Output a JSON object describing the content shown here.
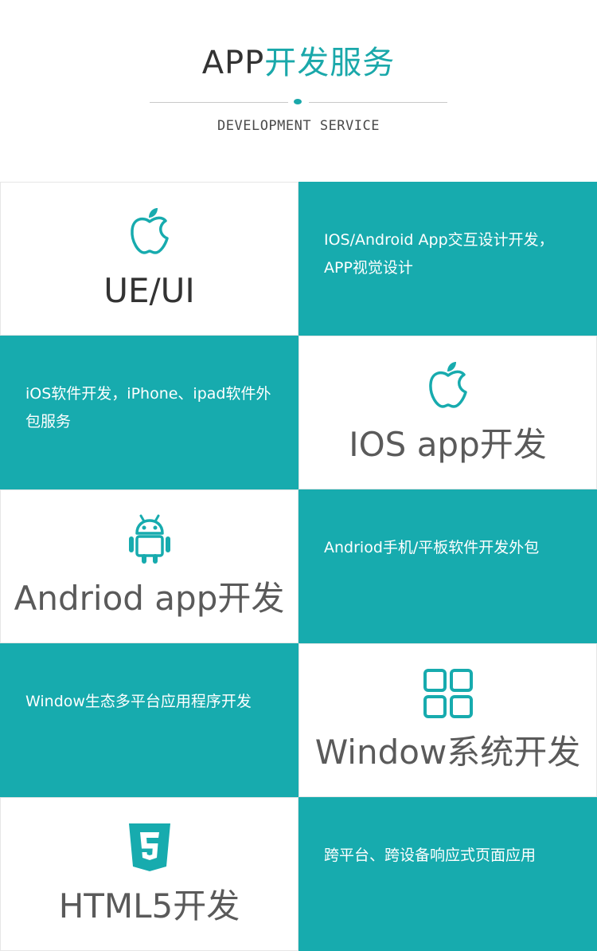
{
  "header": {
    "title_part1": "APP",
    "title_part2": "开发服务",
    "subtitle": "DEVELOPMENT SERVICE"
  },
  "colors": {
    "accent": "#17abae",
    "text_dark": "#333333",
    "text_gray": "#5a5a5a"
  },
  "services": [
    {
      "icon": "apple-icon",
      "title": "UE/UI",
      "description": "IOS/Android App交互设计开发，APP视觉设计"
    },
    {
      "icon": "apple-icon",
      "title": "IOS app开发",
      "description": "iOS软件开发，iPhone、ipad软件外包服务"
    },
    {
      "icon": "android-icon",
      "title": "Andriod app开发",
      "description": "Andriod手机/平板软件开发外包"
    },
    {
      "icon": "windows-grid-icon",
      "title": "Window系统开发",
      "description": "Window生态多平台应用程序开发"
    },
    {
      "icon": "html5-icon",
      "title": "HTML5开发",
      "description": "跨平台、跨设备响应式页面应用"
    }
  ]
}
